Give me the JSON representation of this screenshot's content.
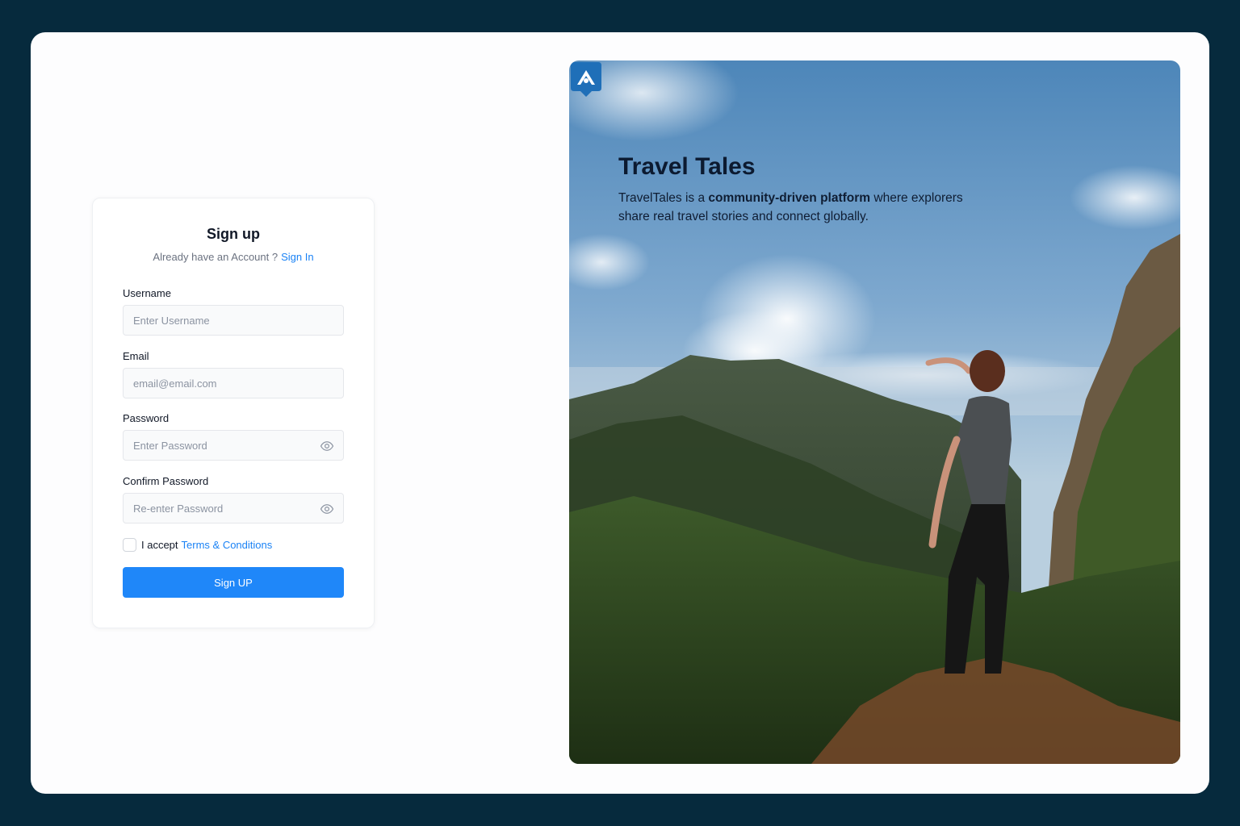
{
  "signup": {
    "title": "Sign up",
    "subtitle": "Already have an Account ?",
    "signin_link": "Sign In",
    "fields": [
      {
        "label": "Username",
        "placeholder": "Enter Username",
        "value": ""
      },
      {
        "label": "Email",
        "placeholder": "email@email.com",
        "value": ""
      },
      {
        "label": "Password",
        "placeholder": "Enter Password",
        "value": "",
        "icon": "eye-icon"
      },
      {
        "label": "Confirm Password",
        "placeholder": "Re-enter Password",
        "value": "",
        "icon": "eye-icon"
      }
    ],
    "terms_prefix": "I accept",
    "terms_link": "Terms & Conditions",
    "terms_checked": false,
    "submit_label": "Sign UP"
  },
  "hero": {
    "logo_icon": "map-pin-mountain-icon",
    "title": "Travel Tales",
    "desc_part1": "TravelTales is a ",
    "desc_bold": "community-driven platform",
    "desc_part2": " where explorers share real travel stories and connect globally.",
    "image": "hiker-on-mountain-cliff-photo"
  },
  "colors": {
    "background": "#062a3d",
    "accent": "#1f87f9",
    "link": "#1a82f5",
    "text_dark": "#111827"
  }
}
